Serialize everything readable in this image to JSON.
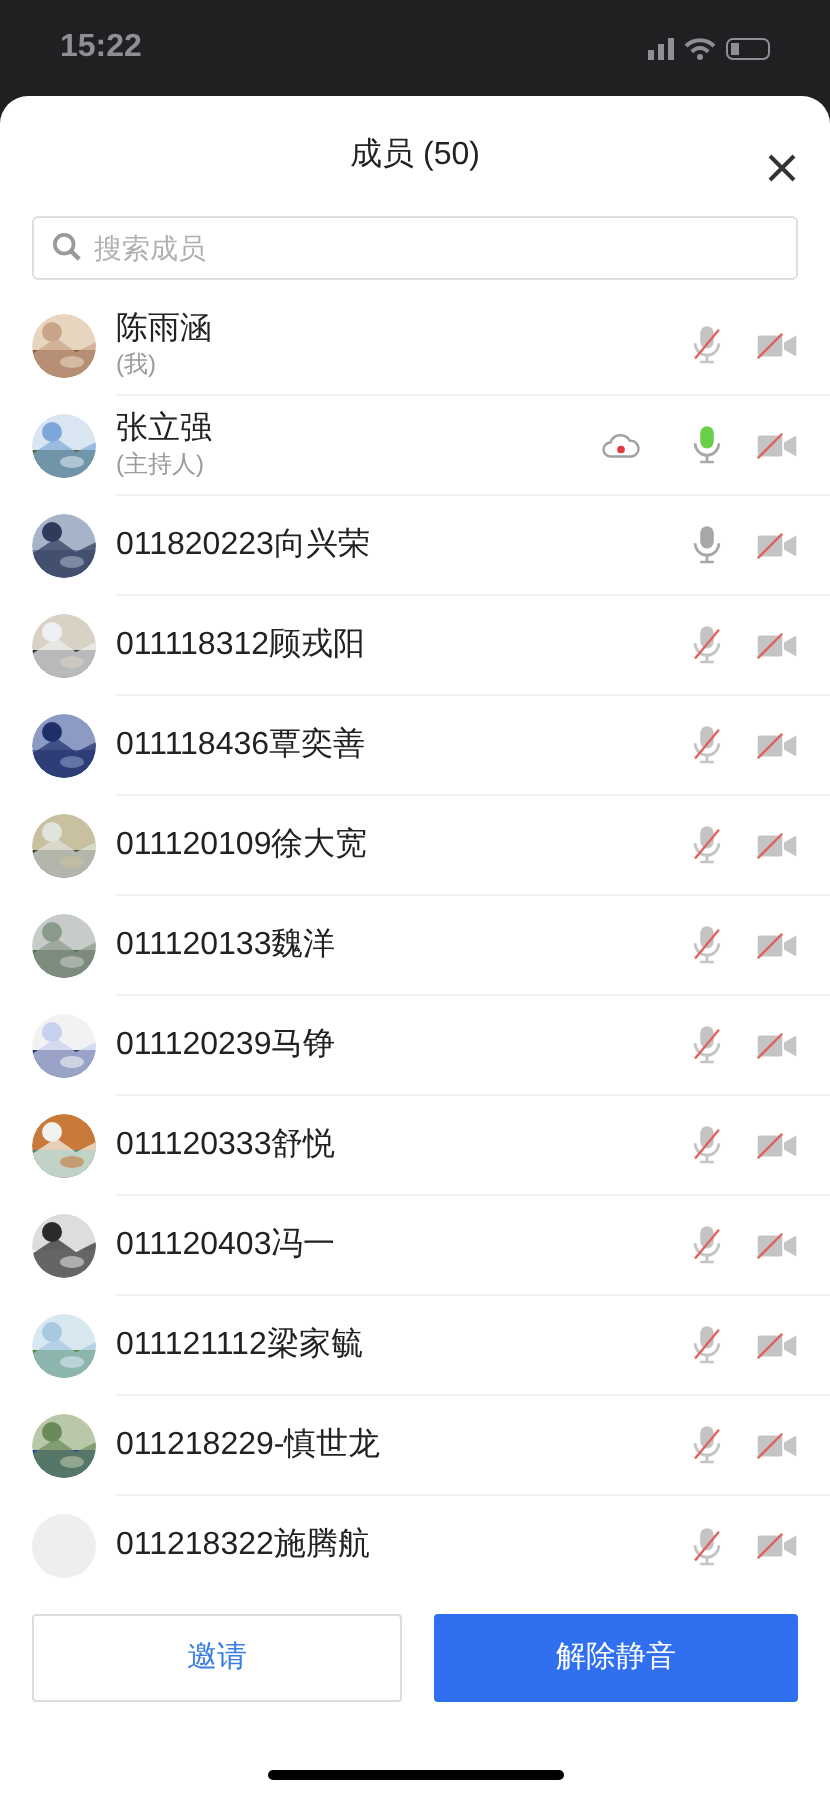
{
  "status_bar": {
    "time": "15:22"
  },
  "title": "成员 (50)",
  "search": {
    "placeholder": "搜索成员"
  },
  "members": [
    {
      "name": "陈雨涵",
      "role": "(我)",
      "avatar_loaded": true,
      "recording": false,
      "muted": true,
      "speaking": false,
      "video_on": false
    },
    {
      "name": "张立强",
      "role": "(主持人)",
      "avatar_loaded": true,
      "recording": true,
      "muted": false,
      "speaking": true,
      "video_on": false
    },
    {
      "name": "011820223向兴荣",
      "avatar_loaded": true,
      "recording": false,
      "muted": false,
      "speaking": false,
      "video_on": false
    },
    {
      "name": "011118312顾戎阳",
      "avatar_loaded": true,
      "recording": false,
      "muted": true,
      "speaking": false,
      "video_on": false
    },
    {
      "name": "011118436覃奕善",
      "avatar_loaded": true,
      "recording": false,
      "muted": true,
      "speaking": false,
      "video_on": false
    },
    {
      "name": "011120109徐大宽",
      "avatar_loaded": true,
      "recording": false,
      "muted": true,
      "speaking": false,
      "video_on": false
    },
    {
      "name": "011120133魏洋",
      "avatar_loaded": true,
      "recording": false,
      "muted": true,
      "speaking": false,
      "video_on": false
    },
    {
      "name": "011120239马铮",
      "avatar_loaded": true,
      "recording": false,
      "muted": true,
      "speaking": false,
      "video_on": false
    },
    {
      "name": "011120333舒悦",
      "avatar_loaded": true,
      "recording": false,
      "muted": true,
      "speaking": false,
      "video_on": false
    },
    {
      "name": "011120403冯一",
      "avatar_loaded": true,
      "recording": false,
      "muted": true,
      "speaking": false,
      "video_on": false
    },
    {
      "name": "011121112梁家毓",
      "avatar_loaded": true,
      "recording": false,
      "muted": true,
      "speaking": false,
      "video_on": false
    },
    {
      "name": "011218229-慎世龙",
      "avatar_loaded": true,
      "recording": false,
      "muted": true,
      "speaking": false,
      "video_on": false
    },
    {
      "name": "011218322施腾航",
      "avatar_loaded": false,
      "recording": false,
      "muted": true,
      "speaking": false,
      "video_on": false
    }
  ],
  "buttons": {
    "invite": "邀请",
    "unmute_all": "解除静音"
  }
}
